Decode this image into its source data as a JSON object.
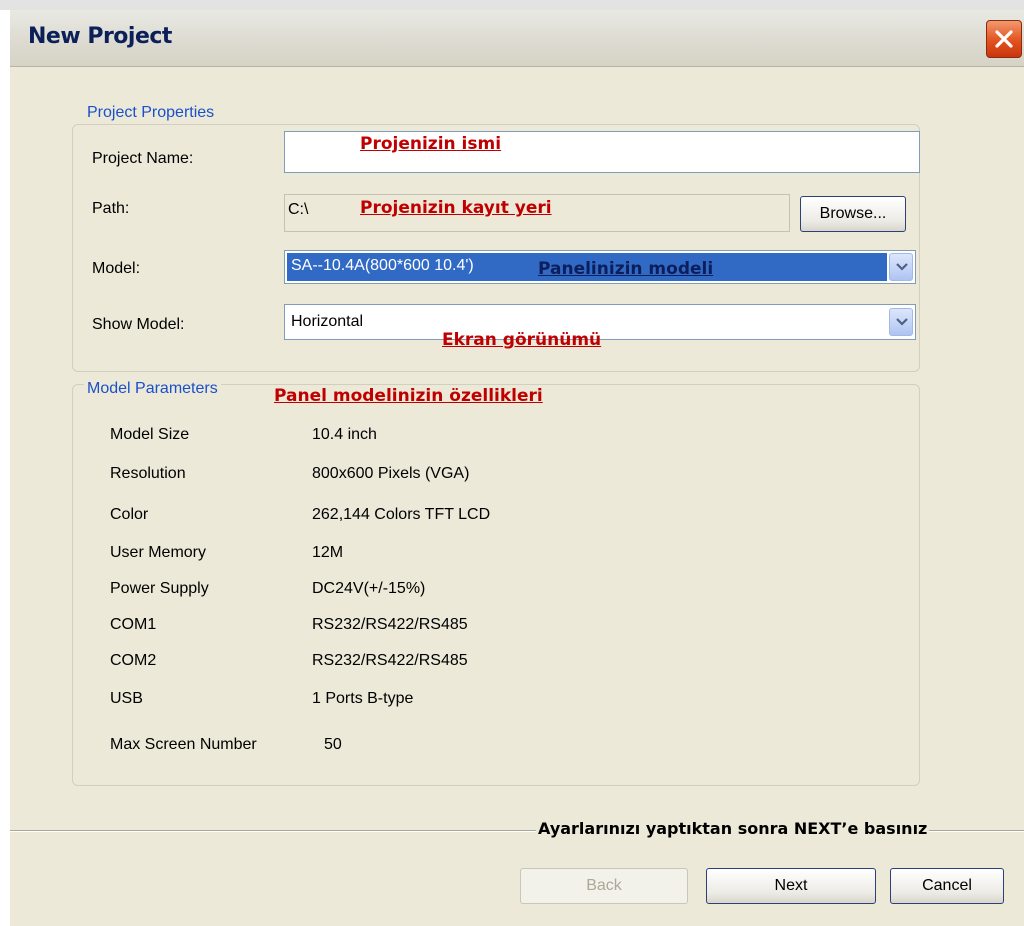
{
  "dialog": {
    "title": "New Project"
  },
  "project_properties": {
    "legend": "Project Properties",
    "project_name": {
      "label": "Project Name:",
      "value": ""
    },
    "path": {
      "label": "Path:",
      "value": "C:\\"
    },
    "browse_label": "Browse...",
    "model": {
      "label": "Model:",
      "value": "SA--10.4A(800*600 10.4')"
    },
    "show_model": {
      "label": "Show Model:",
      "value": "Horizontal"
    }
  },
  "model_parameters": {
    "legend": "Model Parameters",
    "rows": [
      {
        "name": "Model Size",
        "value": "10.4 inch"
      },
      {
        "name": "Resolution",
        "value": "800x600 Pixels (VGA)"
      },
      {
        "name": "Color",
        "value": "262,144 Colors TFT LCD"
      },
      {
        "name": "User Memory",
        "value": "12M"
      },
      {
        "name": "Power Supply",
        "value": "DC24V(+/-15%)"
      },
      {
        "name": "COM1",
        "value": "RS232/RS422/RS485"
      },
      {
        "name": "COM2",
        "value": "RS232/RS422/RS485"
      },
      {
        "name": "USB",
        "value": "1 Ports B-type"
      },
      {
        "name": "Max Screen Number",
        "value": "50"
      }
    ]
  },
  "annotations": {
    "project_name": "Projenizin ismi",
    "path": "Projenizin kayıt yeri",
    "model": "Panelinizin modeli",
    "show_model": "Ekran görünümü",
    "parameters": "Panel modelinizin özellikleri",
    "footer": "Ayarlarınızı yaptıktan sonra NEXT’e basınız"
  },
  "buttons": {
    "back": "Back",
    "next": "Next",
    "cancel": "Cancel"
  },
  "colors": {
    "dialog_bg": "#ece9d8",
    "legend_text": "#1b50c9",
    "annotation_red": "#c00000",
    "selection_blue": "#316ac5",
    "close_button": "#e2521f"
  }
}
